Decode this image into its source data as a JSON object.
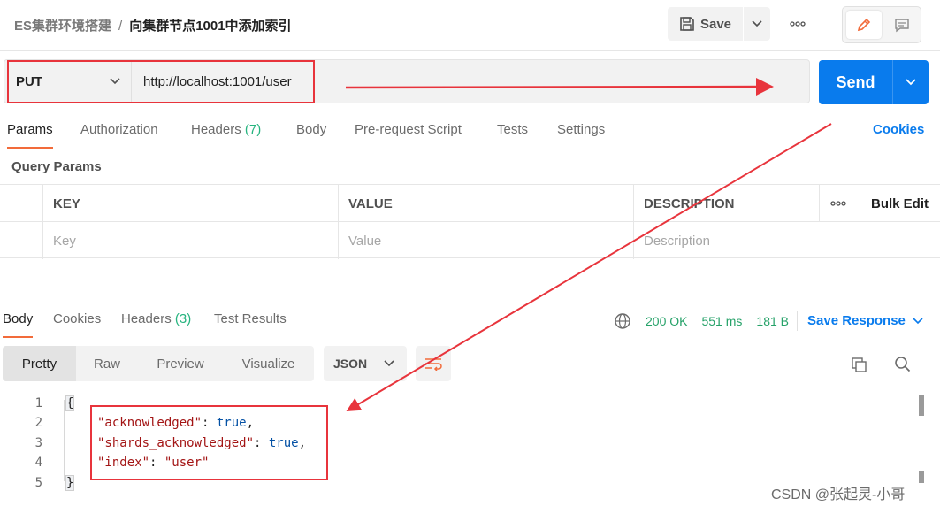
{
  "header": {
    "breadcrumb_parent": "ES集群环境搭建",
    "breadcrumb_sep": "/",
    "breadcrumb_current": "向集群节点1001中添加索引",
    "save_label": "Save"
  },
  "request": {
    "method": "PUT",
    "url": "http://localhost:1001/user",
    "send_label": "Send"
  },
  "request_tabs": [
    {
      "label": "Params",
      "count": ""
    },
    {
      "label": "Authorization",
      "count": ""
    },
    {
      "label": "Headers",
      "count": "(7)"
    },
    {
      "label": "Body",
      "count": ""
    },
    {
      "label": "Pre-request Script",
      "count": ""
    },
    {
      "label": "Tests",
      "count": ""
    },
    {
      "label": "Settings",
      "count": ""
    }
  ],
  "cookies_link": "Cookies",
  "query_params": {
    "title": "Query Params",
    "columns": [
      "KEY",
      "VALUE",
      "DESCRIPTION"
    ],
    "bulk_edit": "Bulk Edit",
    "placeholders": [
      "Key",
      "Value",
      "Description"
    ]
  },
  "response_tabs": [
    {
      "label": "Body",
      "count": ""
    },
    {
      "label": "Cookies",
      "count": ""
    },
    {
      "label": "Headers",
      "count": "(3)"
    },
    {
      "label": "Test Results",
      "count": ""
    }
  ],
  "response_status": {
    "code": "200 OK",
    "time": "551 ms",
    "size": "181 B",
    "save_response": "Save Response"
  },
  "view_modes": [
    "Pretty",
    "Raw",
    "Preview",
    "Visualize"
  ],
  "format": "JSON",
  "code_lines": [
    {
      "num": "1",
      "text": "{"
    },
    {
      "num": "2",
      "key": "\"acknowledged\"",
      "sep": ": ",
      "val": "true",
      "tail": ","
    },
    {
      "num": "3",
      "key": "\"shards_acknowledged\"",
      "sep": ": ",
      "val": "true",
      "tail": ","
    },
    {
      "num": "4",
      "key": "\"index\"",
      "sep": ": ",
      "val": "\"user\"",
      "tail": ""
    },
    {
      "num": "5",
      "text": "}"
    }
  ],
  "watermark": "CSDN @张起灵-小哥",
  "colors": {
    "accent_blue": "#097bed",
    "tab_underline": "#f26b3a",
    "status_green": "#26a269",
    "annotation_red": "#e8343c"
  }
}
